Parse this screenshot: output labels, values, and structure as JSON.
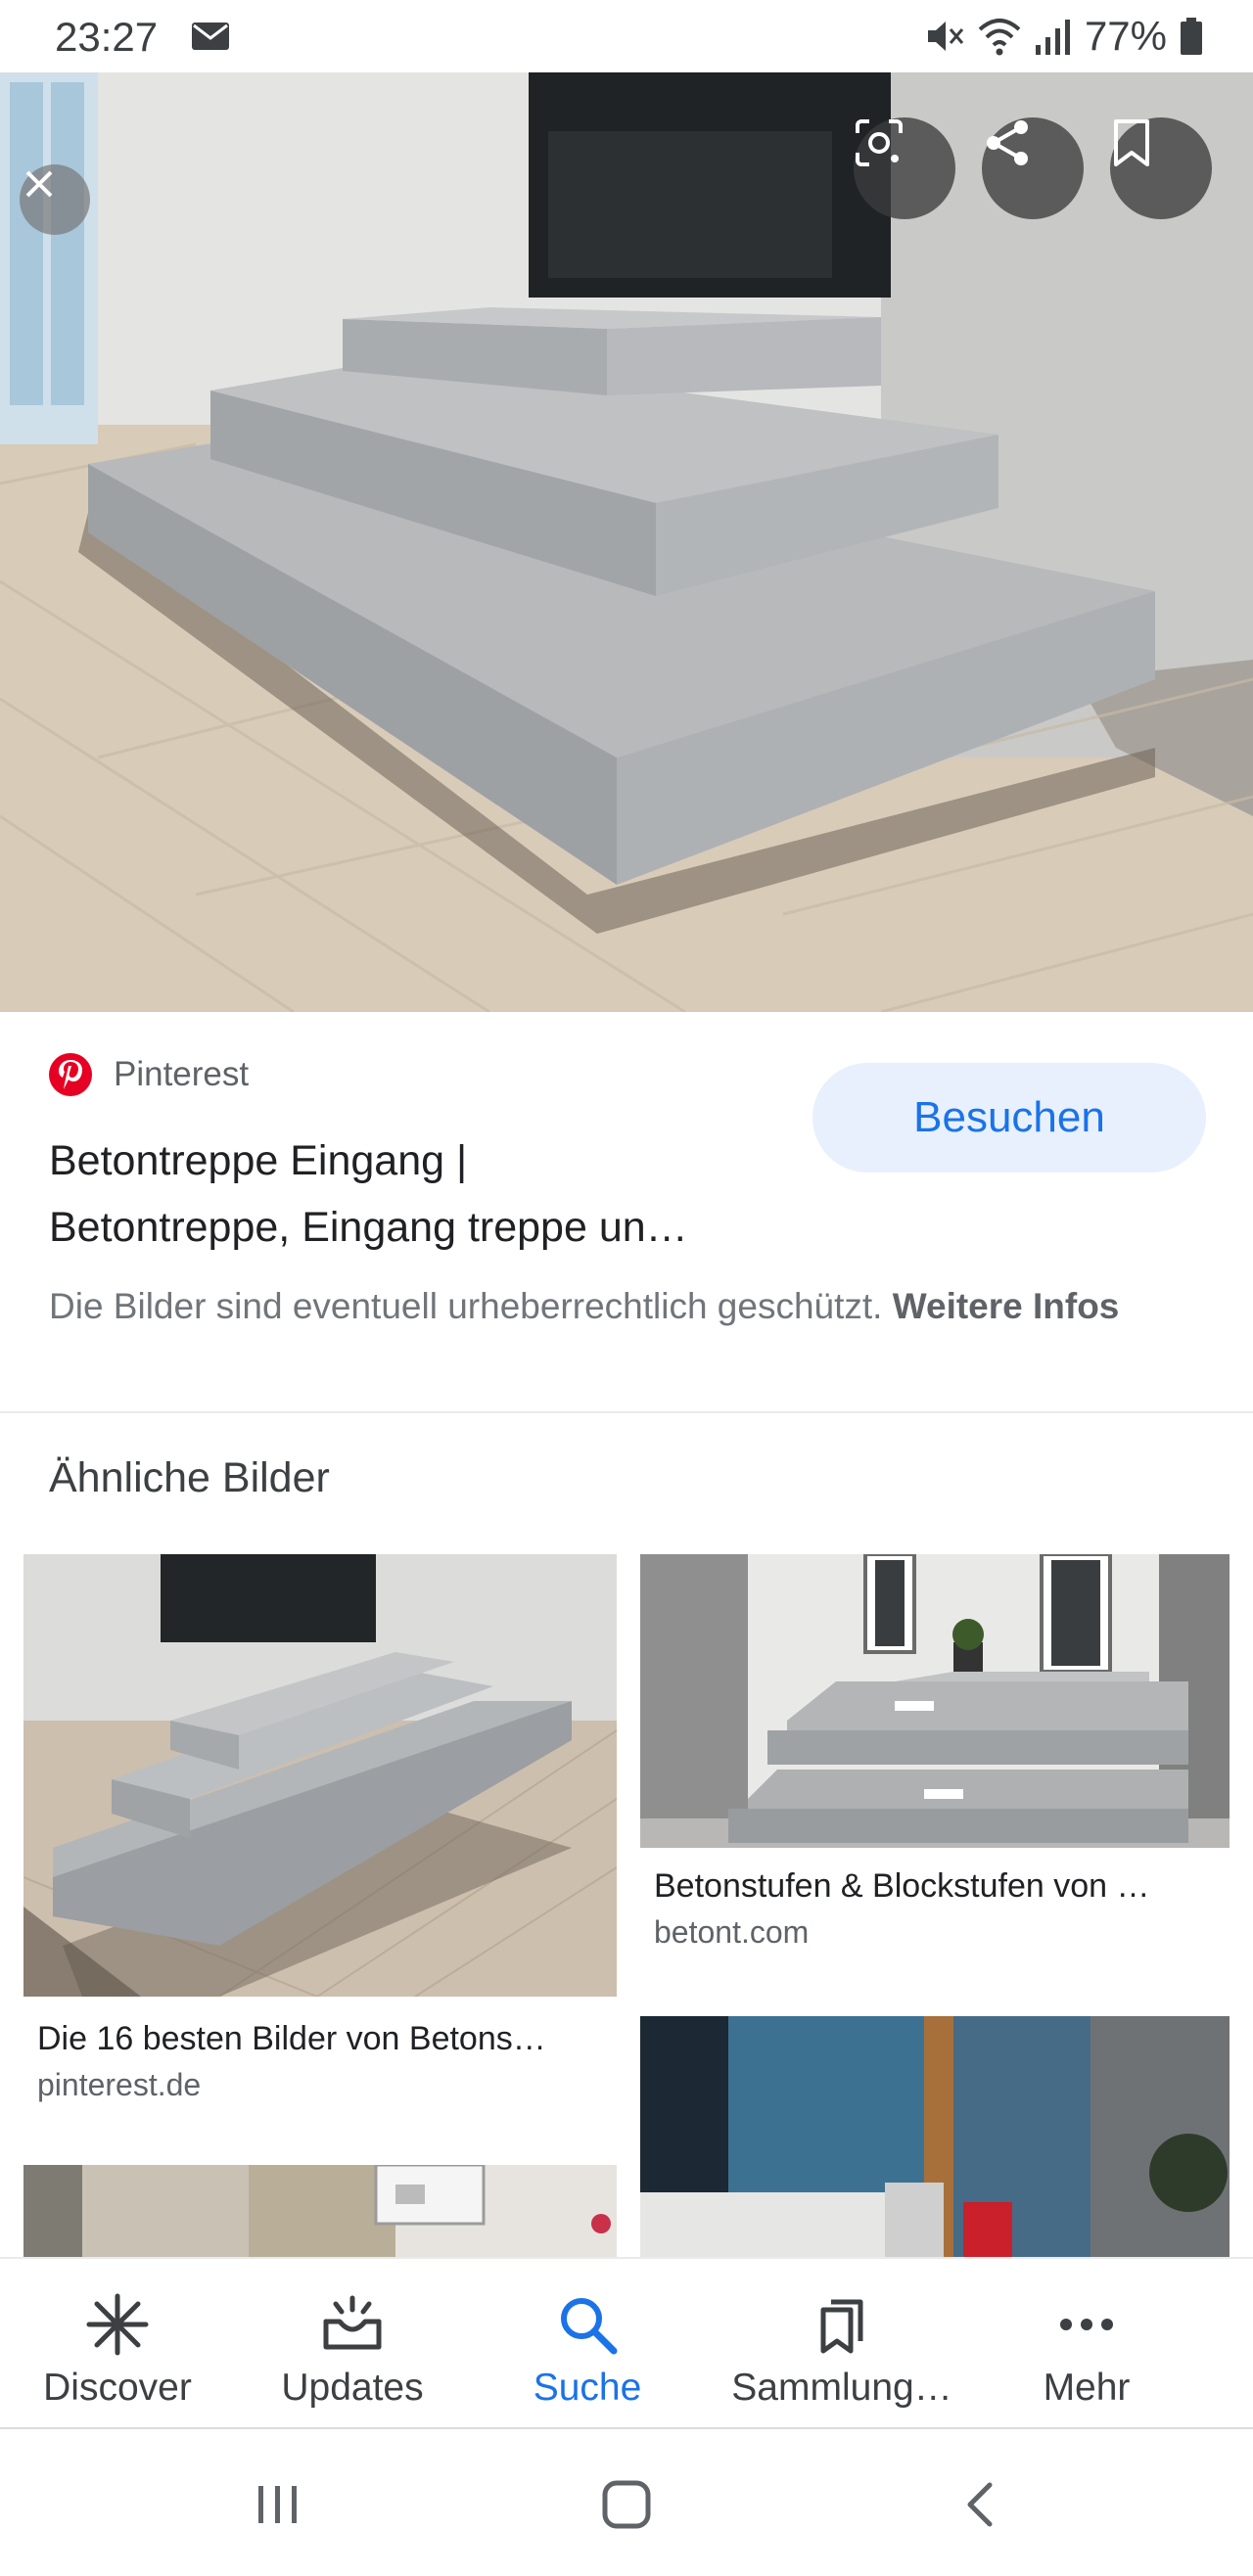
{
  "status_bar": {
    "time": "23:27",
    "battery": "77%",
    "icons": [
      "mail-icon",
      "mute-icon",
      "wifi-icon",
      "signal-icon",
      "battery-icon"
    ]
  },
  "hero": {
    "icons": [
      "close-icon",
      "lens-icon",
      "share-icon",
      "bookmark-icon"
    ]
  },
  "result": {
    "source": "Pinterest",
    "visit_label": "Besuchen",
    "title_line1": "Betontreppe Eingang |",
    "title_line2": "Betontreppe, Eingang treppe un…",
    "copyright_text": "Die Bilder sind eventuell urheberrechtlich geschützt.",
    "more_info": "Weitere Infos"
  },
  "similar": {
    "heading": "Ähnliche Bilder",
    "items": [
      {
        "caption": "Die 16 besten Bilder von Betons…",
        "domain": "pinterest.de"
      },
      {
        "caption": "Betonstufen & Blockstufen von …",
        "domain": "betont.com"
      }
    ]
  },
  "bottom_nav": {
    "items": [
      {
        "label": "Discover",
        "icon": "asterisk-icon"
      },
      {
        "label": "Updates",
        "icon": "inbox-icon"
      },
      {
        "label": "Suche",
        "icon": "search-icon",
        "active": true
      },
      {
        "label": "Sammlung…",
        "icon": "collections-icon"
      },
      {
        "label": "Mehr",
        "icon": "more-icon"
      }
    ]
  },
  "colors": {
    "accent": "#1a73e8",
    "visit_bg": "#e8f0fe",
    "pinterest": "#e60023"
  }
}
